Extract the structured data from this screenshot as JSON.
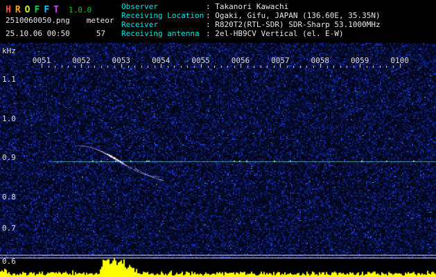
{
  "header": {
    "title_letters": [
      {
        "ch": "H",
        "color": "#ff4444"
      },
      {
        "ch": "R",
        "color": "#ffaa00"
      },
      {
        "ch": "O",
        "color": "#ccff00"
      },
      {
        "ch": "F",
        "color": "#00dd44"
      },
      {
        "ch": "F",
        "color": "#00ccff"
      },
      {
        "ch": "T",
        "color": "#cc44ff"
      }
    ],
    "version": "1.0.0",
    "version_color": "#00cc00",
    "filename": "2510060050.png",
    "mode": "meteor",
    "datetime": "25.10.06 00:50",
    "count": "57",
    "label_color": "#00e5e5",
    "value_color": "#e8e8e8",
    "info_rows": [
      {
        "label": "Observer",
        "value": ": Takanori Kawachi"
      },
      {
        "label": "Receiving Location",
        "value": ": Ogaki, Gifu, JAPAN (136.60E, 35.35N)"
      },
      {
        "label": "Receiver",
        "value": ": R820T2(RTL-SDR) SDR-Sharp 53.1000MHz"
      },
      {
        "label": "Receiving antenna",
        "value": ": 2el-HB9CV Vertical (el. E-W)"
      }
    ]
  },
  "chart_data": {
    "type": "heatmap",
    "title": "HROFFT radio meteor spectrogram",
    "y_unit": "kHz",
    "x_ticks": [
      "0051",
      "0052",
      "0053",
      "0054",
      "0055",
      "0056",
      "0057",
      "0058",
      "0059",
      "0100"
    ],
    "y_ticks": [
      "1.1",
      "1.0",
      "0.9",
      "0.8",
      "0.7",
      "0.6"
    ],
    "x_range": [
      "00:51",
      "01:00"
    ],
    "y_range_khz": [
      0.6,
      1.15
    ],
    "carrier_line": {
      "freq_khz": 0.9,
      "color": "#00dd77",
      "starts_at": "0051.3"
    },
    "meteor_echo": {
      "time": "0052-0053",
      "freq_start_khz": 0.94,
      "freq_end_khz": 0.8,
      "description": "doppler-shifted echo trace crossing the 0.9 kHz carrier"
    },
    "level_graph": {
      "color": "#ffff00",
      "burst_time": "0052.5",
      "baseline": "noise floor"
    },
    "noise_color": "#0a1560"
  }
}
